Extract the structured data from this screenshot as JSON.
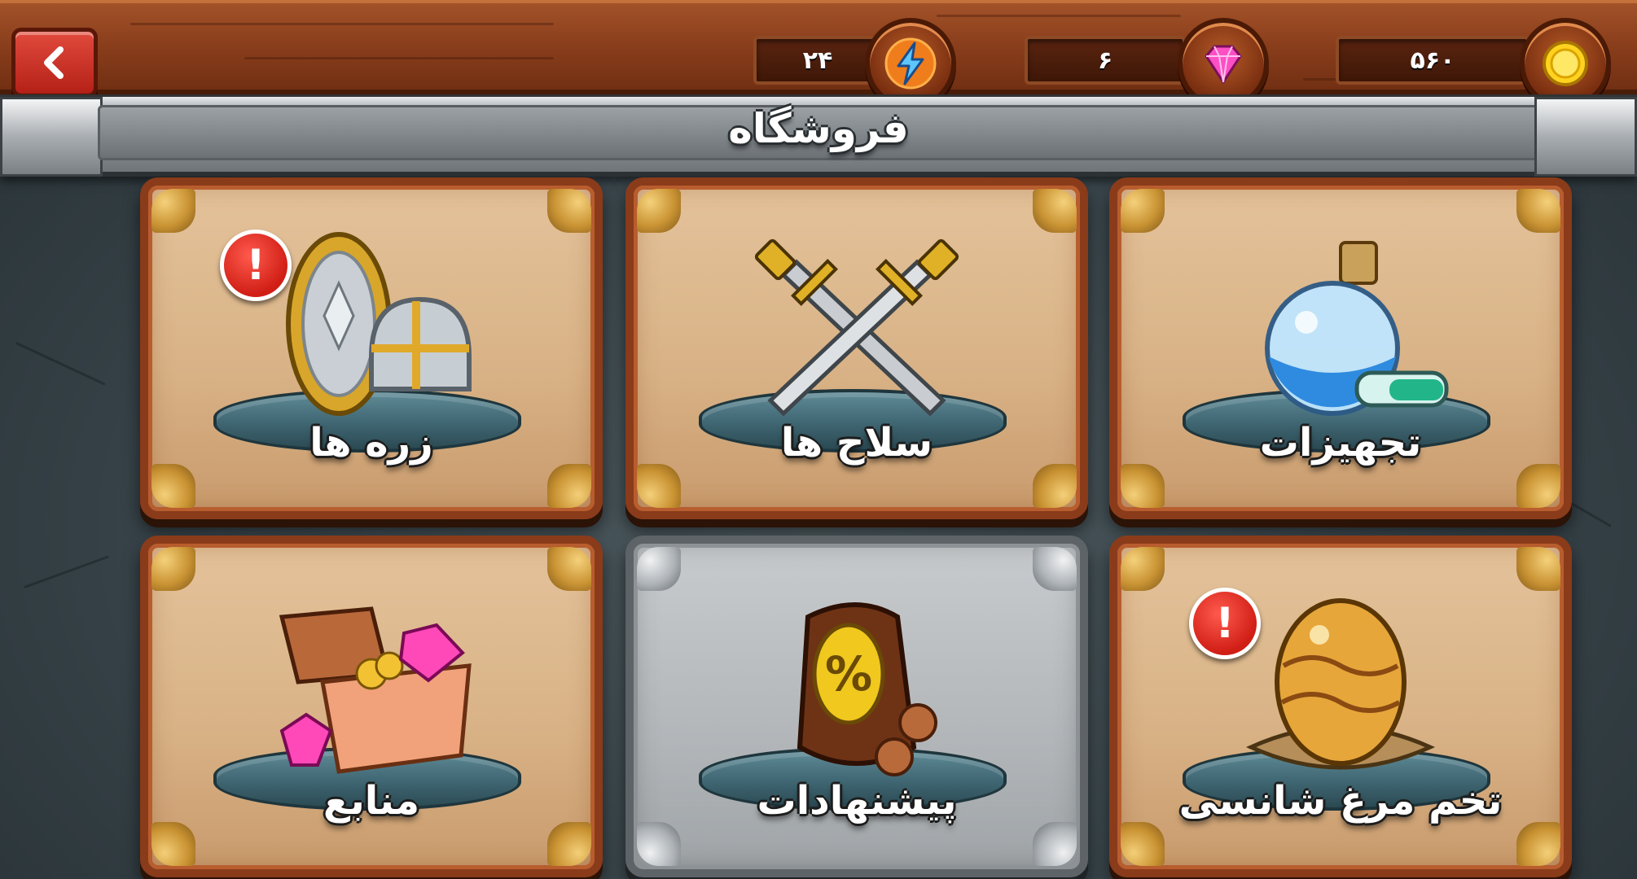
{
  "header": {
    "back_icon": "chevron-left-icon",
    "resources": [
      {
        "name": "energy",
        "icon": "lightning-icon",
        "value": "۲۴"
      },
      {
        "name": "gems",
        "icon": "gem-icon",
        "value": "۶"
      },
      {
        "name": "coins",
        "icon": "coin-icon",
        "value": "۵۶۰"
      }
    ]
  },
  "title": "فروشگاه",
  "cards": [
    {
      "id": "armor",
      "label": "زره ها",
      "icon": "shield-helmet-icon",
      "alert": true,
      "style": "bronze"
    },
    {
      "id": "weapons",
      "label": "سلاح ها",
      "icon": "crossed-swords-icon",
      "alert": false,
      "style": "bronze"
    },
    {
      "id": "equipment",
      "label": "تجهیزات",
      "icon": "potion-icon",
      "alert": false,
      "style": "bronze"
    },
    {
      "id": "resources",
      "label": "منابع",
      "icon": "treasure-chest-icon",
      "alert": false,
      "style": "bronze"
    },
    {
      "id": "offers",
      "label": "پیشنهادات",
      "icon": "discount-bag-icon",
      "alert": false,
      "style": "silver"
    },
    {
      "id": "lucky-egg",
      "label": "تخم مرغ شانسی",
      "icon": "golden-egg-icon",
      "alert": true,
      "style": "bronze"
    }
  ],
  "colors": {
    "wood": "#8b3f1c",
    "card_bronze": "#d9b387",
    "card_silver": "#b2b6b9",
    "alert": "#d01e15",
    "pedestal": "#3f6672"
  }
}
